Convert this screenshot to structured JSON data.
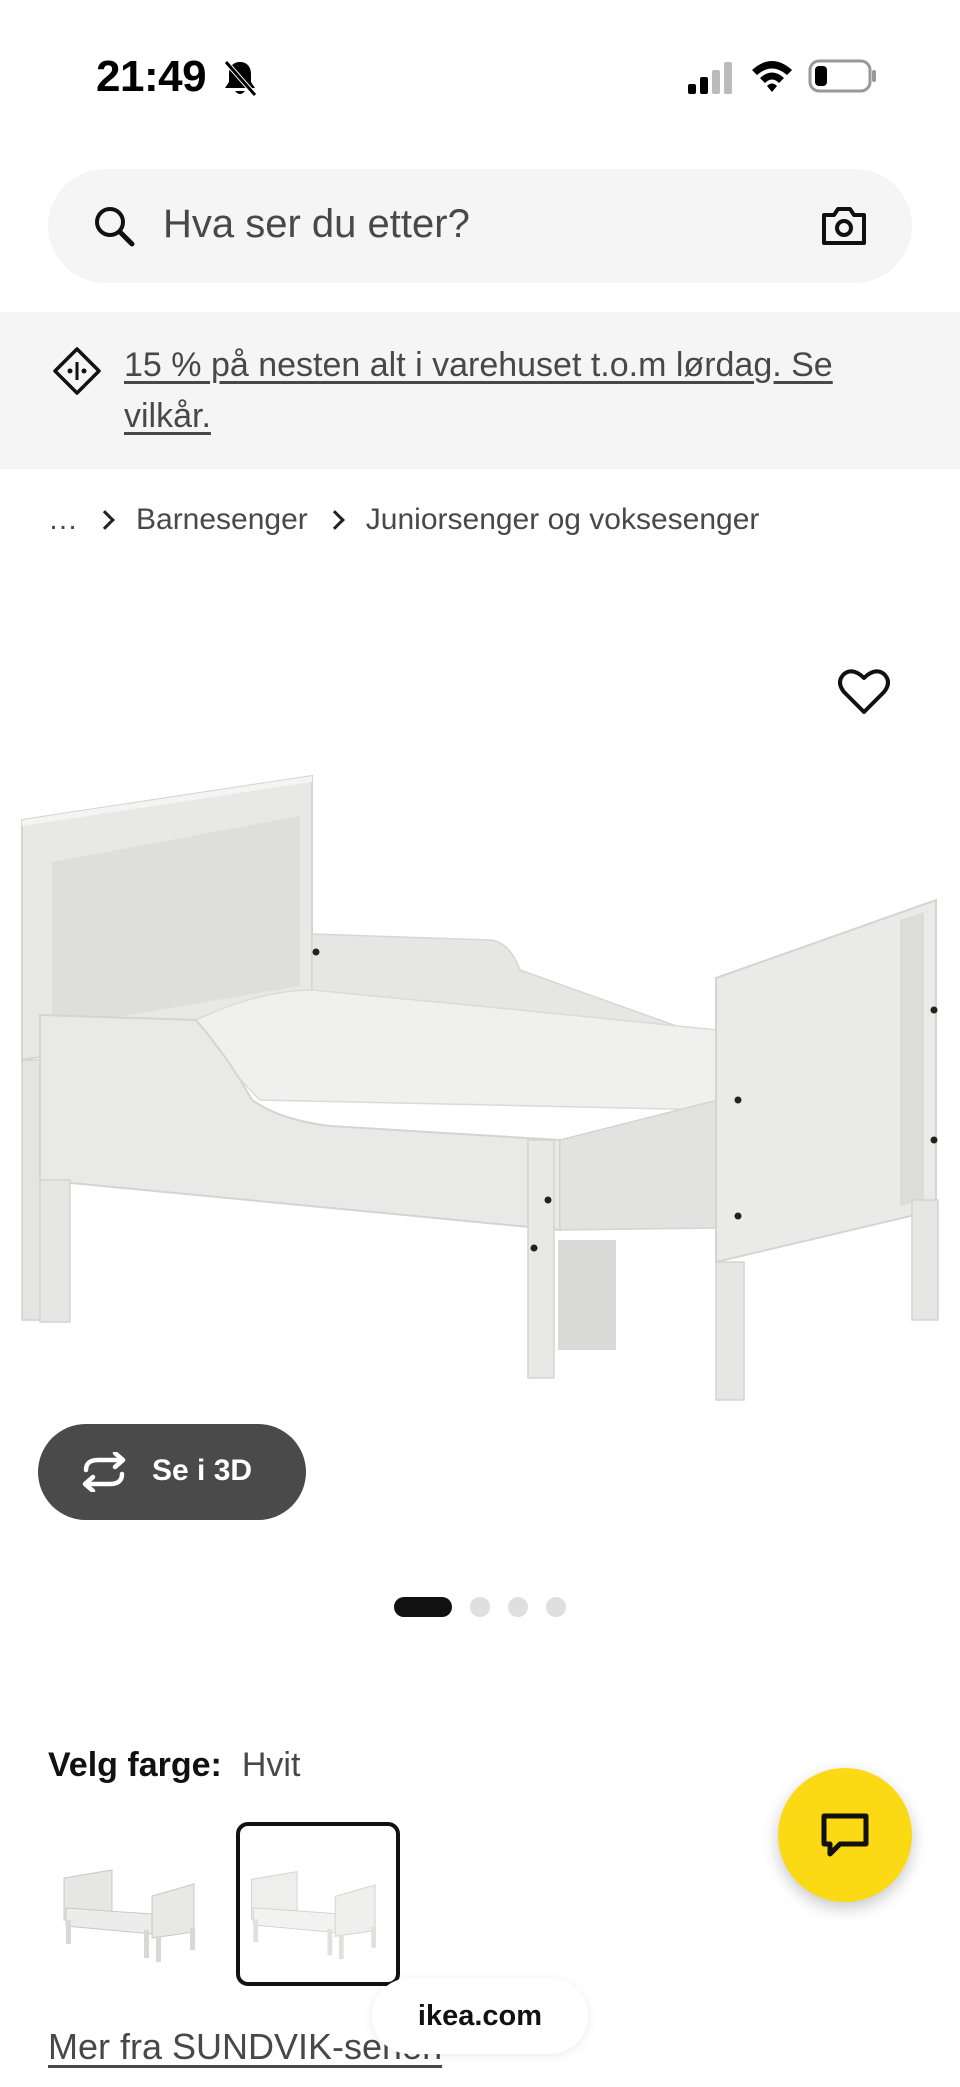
{
  "status_bar": {
    "time": "21:49",
    "bell_icon": "bell-slash-icon",
    "signal_icon": "cellular-signal-icon",
    "wifi_icon": "wifi-icon",
    "battery_icon": "battery-low-icon"
  },
  "search": {
    "placeholder": "Hva ser du etter?",
    "search_icon": "search-icon",
    "camera_icon": "camera-icon"
  },
  "promo": {
    "text": "15 % på nesten alt i varehuset t.o.m lørdag. Se vilkår.",
    "icon": "price-tag-icon"
  },
  "breadcrumb": {
    "items": [
      "…",
      "Barnesenger",
      "Juniorsenger og voksesenger"
    ]
  },
  "product": {
    "favorite_icon": "heart-icon",
    "view_3d_label": "Se i 3D",
    "view_3d_icon": "rotate-icon",
    "carousel": {
      "total": 4,
      "active": 1
    }
  },
  "color_picker": {
    "label": "Velg farge:",
    "selected": "Hvit",
    "options_count": 2,
    "selected_index": 2
  },
  "series_link": "Mer fra SUNDVIK-serien",
  "chat": {
    "icon": "chat-bubble-icon",
    "color": "#fbd914"
  },
  "browser": {
    "url": "ikea.com"
  }
}
